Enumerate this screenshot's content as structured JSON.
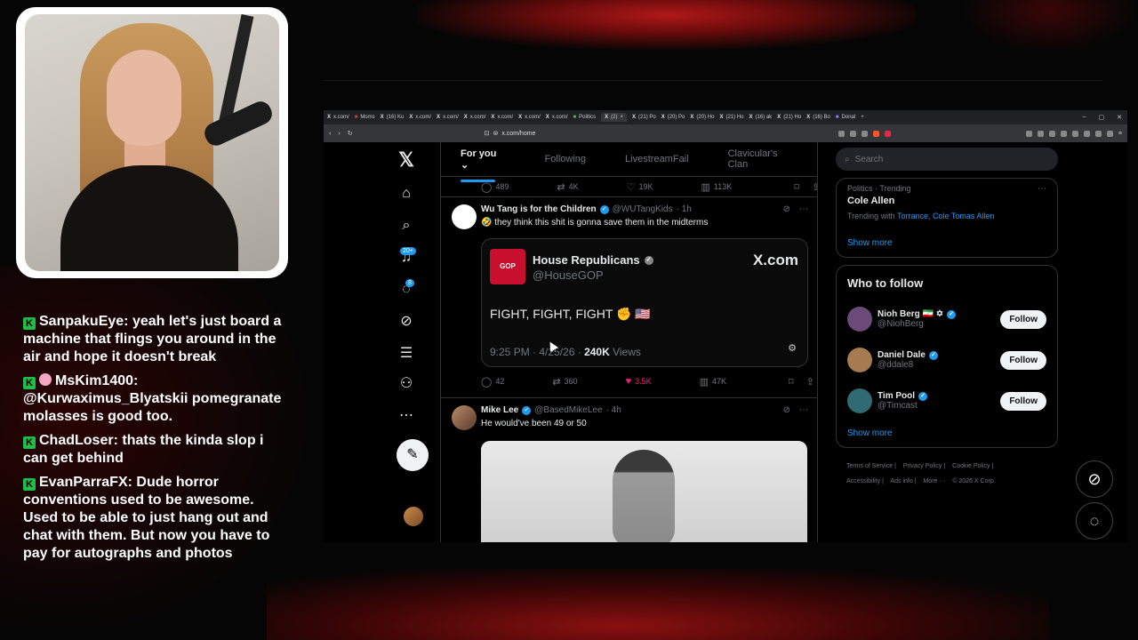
{
  "chat": [
    {
      "user": "SanpakuEye:",
      "text": "yeah let's just board a machine that flings you around in the air and hope it doesn't break",
      "special": false
    },
    {
      "user": "MsKim1400:",
      "text": "@Kurwaximus_Blyatskii pomegranate molasses is good too.",
      "special": true
    },
    {
      "user": "ChadLoser:",
      "text": "thats the kinda slop i can get behind",
      "special": false
    },
    {
      "user": "EvanParraFX:",
      "text": "Dude horror conventions used to be awesome. Used to be able to just hang out and chat with them. But now you have to pay for autographs and photos",
      "special": false
    }
  ],
  "browser": {
    "tabs": [
      "x.com/",
      "Moms",
      "(16) Ku",
      "x.com/",
      "x.com/",
      "x.com/",
      "x.com/",
      "x.com/",
      "x.com/",
      "Politics",
      "(2)",
      "(21) Po",
      "(20) Po",
      "(20) Ho",
      "(21) Ho",
      "(16) ak",
      "(21) Ho",
      "(16) Bo",
      "Donal"
    ],
    "url": "x.com/home"
  },
  "nav": {
    "notif_badge": "20+",
    "msg_badge": "8"
  },
  "timeline": {
    "tabs": [
      "For you",
      "Following",
      "LivestreamFail",
      "Clavicular's Clan"
    ],
    "prev_actions": {
      "replies": "489",
      "reposts": "4K",
      "likes": "19K",
      "views": "113K"
    },
    "tweet1": {
      "name": "Wu Tang is for the Children",
      "handle": "@WUTangKids",
      "time": "· 1h",
      "text": "🤣 they think this shit is gonna save them in the midterms",
      "card": {
        "logo": "GOP",
        "name": "House Republicans",
        "handle": "@HouseGOP",
        "brand": "X.com",
        "body": "FIGHT, FIGHT, FIGHT ✊ 🇺🇸",
        "time": "9:25 PM · 4/25/26 · ",
        "views_num": "240K",
        "views_label": " Views"
      },
      "actions": {
        "replies": "42",
        "reposts": "360",
        "likes": "3.5K",
        "views": "47K"
      }
    },
    "tweet2": {
      "name": "Mike Lee",
      "handle": "@BasedMikeLee",
      "time": "· 4h",
      "text": "He would've been 49 or 50"
    }
  },
  "right": {
    "search_placeholder": "Search",
    "trend_cat": "Politics · Trending",
    "trend_title": "Cole Allen",
    "trend_with_prefix": "Trending with ",
    "trend_with_links": "Torrance, Cole Tomas Allen",
    "show_more": "Show more",
    "wtf_title": "Who to follow",
    "wtf": [
      {
        "name": "Nioh Berg 🇮🇷 ✡",
        "handle": "@NiohBerg",
        "button": "Follow",
        "color": "#6b4a7a"
      },
      {
        "name": "Daniel Dale",
        "handle": "@ddale8",
        "button": "Follow",
        "color": "#a67b4f"
      },
      {
        "name": "Tim Pool",
        "handle": "@Timcast",
        "button": "Follow",
        "color": "#2f6b70"
      }
    ],
    "wtf_show_more": "Show more",
    "footer": [
      "Terms of Service |",
      "Privacy Policy |",
      "Cookie Policy |",
      "Accessibility |",
      "Ads info |",
      "More ···",
      "© 2026 X Corp."
    ]
  },
  "colors": {
    "accent": "#1d9bf0",
    "like": "#f91880",
    "chat_badge": "#1fbf46"
  }
}
